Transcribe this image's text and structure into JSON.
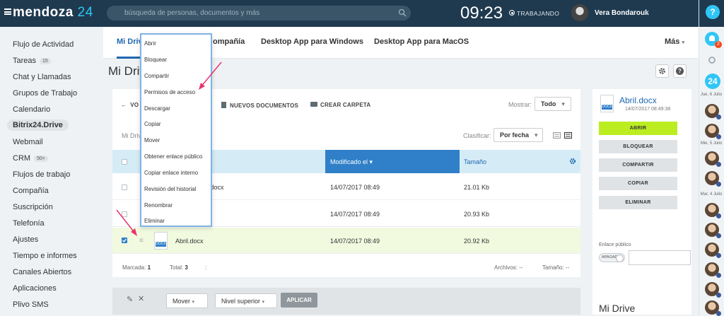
{
  "header": {
    "logo_text": "mendoza",
    "logo_num": "24",
    "search_placeholder": "búsqueda de personas, documentos y más",
    "clock": "09:23",
    "status": "TRABAJANDO",
    "user_name": "Vera Bondarouk"
  },
  "sidebar": {
    "items": [
      {
        "label": "Flujo de Actividad"
      },
      {
        "label": "Tareas",
        "badge": "15"
      },
      {
        "label": "Chat y Llamadas"
      },
      {
        "label": "Grupos de Trabajo"
      },
      {
        "label": "Calendario"
      },
      {
        "label": "Bitrix24.Drive"
      },
      {
        "label": "Webmail"
      },
      {
        "label": "CRM",
        "badge": "50+"
      },
      {
        "label": "Flujos de trabajo"
      },
      {
        "label": "Compañía"
      },
      {
        "label": "Suscripción"
      },
      {
        "label": "Telefonía"
      },
      {
        "label": "Ajustes"
      },
      {
        "label": "Tiempo e informes"
      },
      {
        "label": "Canales Abiertos"
      },
      {
        "label": "Aplicaciones"
      },
      {
        "label": "Plivo SMS"
      }
    ]
  },
  "tabs": {
    "t1": "Mi Drive",
    "t2": "ompañía",
    "t3": "Desktop App para Windows",
    "t4": "Desktop App para MacOS",
    "more": "Más"
  },
  "page": {
    "title": "Mi Drive"
  },
  "toolbar": {
    "back": "VO",
    "new_docs": "NUEVOS DOCUMENTOS",
    "new_folder": "CREAR CARPETA",
    "show_label": "Mostrar:",
    "show_value": "Todo",
    "breadcrumb": "Mi Drive",
    "sort_label": "Clasificar:",
    "sort_value": "Por fecha"
  },
  "table": {
    "col_modified": "Modificado el",
    "col_size": "Tamaño",
    "rows": [
      {
        "name": "Abril.docx",
        "visible_name": ".docx",
        "modified": "14/07/2017 08:49",
        "size": "21.01 Kb",
        "checked": false
      },
      {
        "name": "",
        "visible_name": "",
        "modified": "14/07/2017 08:49",
        "size": "20.93 Kb",
        "checked": false
      },
      {
        "name": "Abril.docx",
        "visible_name": "Abril.docx",
        "modified": "14/07/2017 08:49",
        "size": "20.92 Kb",
        "checked": true
      }
    ],
    "footer": {
      "marked_label": "Marcada:",
      "marked_value": "1",
      "total_label": "Total:",
      "total_value": "3",
      "files_label": "Archivos:",
      "files_value": "--",
      "size_label": "Tamaño:",
      "size_value": "--"
    }
  },
  "bottombar": {
    "move": "Mover",
    "level": "Nivel superior",
    "apply": "APLICAR"
  },
  "context_menu": {
    "items": [
      "Abrir",
      "Bloquear",
      "Compartir",
      "Permisos de acceso",
      "Descargar",
      "Copiar",
      "Mover",
      "Obtener enlace público",
      "Copiar enlace interno",
      "Revisión del historial",
      "Renombrar",
      "Eliminar"
    ]
  },
  "right_panel": {
    "filename": "Abril.docx",
    "date": "14/07/2017 08:49:38",
    "buttons": [
      "ABRIR",
      "BLOQUEAR",
      "COMPARTIR",
      "COPIAR",
      "ELIMINAR"
    ],
    "public_link_label": "Enlace público",
    "toggle_label": "APAGADO",
    "drive_title": "Mi Drive"
  },
  "right_strip": {
    "notif_count": "2",
    "b24": "24",
    "dates": [
      "Jue, 6 Julio",
      "Mie, 5 Julio",
      "Mar, 4 Julio"
    ]
  },
  "colors": {
    "header_bg": "#1f3a4f",
    "accent_blue": "#2f80c8",
    "link_blue": "#2067b0",
    "open_green": "#bbed21",
    "arrow_pink": "#e8356d"
  }
}
